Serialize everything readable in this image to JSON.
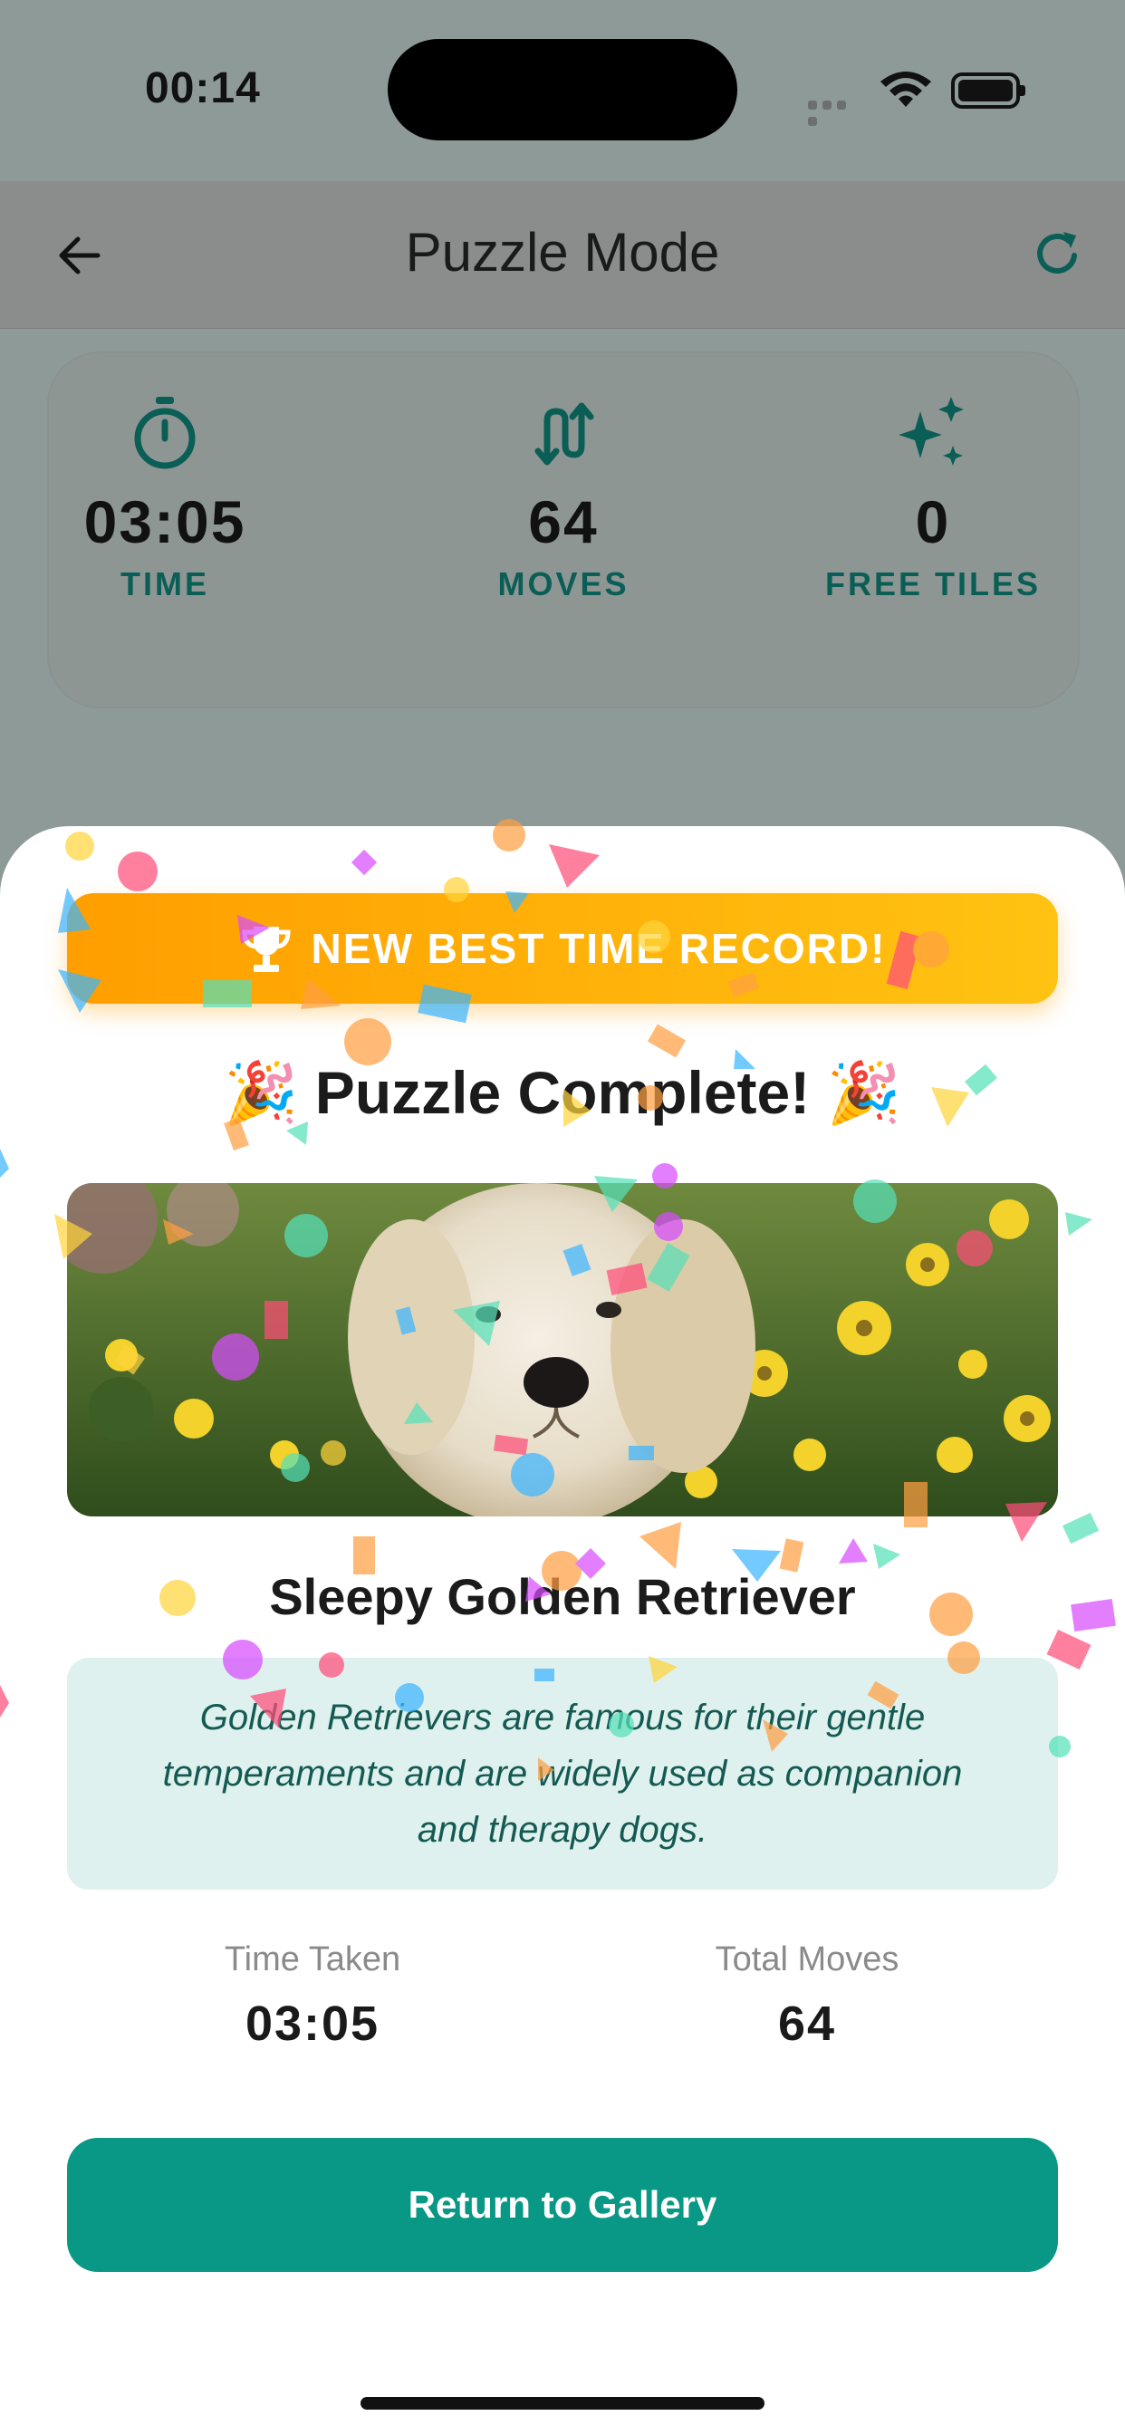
{
  "status": {
    "time": "00:14"
  },
  "nav": {
    "title": "Puzzle Mode"
  },
  "stats": [
    {
      "icon": "stopwatch-icon",
      "value": "03:05",
      "label": "TIME"
    },
    {
      "icon": "swap-arrows-icon",
      "value": "64",
      "label": "MOVES"
    },
    {
      "icon": "sparkles-icon",
      "value": "0",
      "label": "FREE TILES"
    }
  ],
  "modal": {
    "record_label": "NEW BEST TIME RECORD!",
    "complete_title": "🎉 Puzzle Complete! 🎉",
    "pet_name": "Sleepy Golden Retriever",
    "fact": "Golden Retrievers are famous for their gentle temperaments and are widely used as companion and therapy dogs.",
    "time_taken_label": "Time Taken",
    "time_taken_value": "03:05",
    "total_moves_label": "Total Moves",
    "total_moves_value": "64",
    "return_button": "Return to Gallery"
  },
  "colors": {
    "accent": "#0a9886",
    "record_start": "#ff9e00",
    "record_end": "#ffc312",
    "fact_bg": "#dff1ee"
  }
}
